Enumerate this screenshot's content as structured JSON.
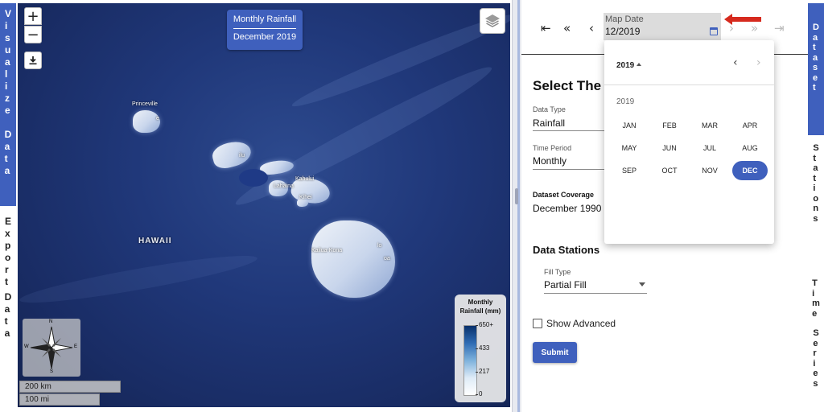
{
  "left_tabs": {
    "visualize": [
      "V",
      "i",
      "s",
      "u",
      "a",
      "l",
      "i",
      "z",
      "e"
    ],
    "data": [
      "D",
      "a",
      "t",
      "a"
    ],
    "export": [
      "E",
      "x",
      "p",
      "o",
      "r",
      "t"
    ],
    "data2": [
      "D",
      "a",
      "t",
      "a"
    ]
  },
  "map": {
    "zoom_in": "+",
    "zoom_out": "−",
    "download_icon": "download-icon",
    "layers_icon": "layers-icon",
    "title_line1": "Monthly Rainfall",
    "title_line2": "December 2019",
    "places": {
      "princeville": "Princeville",
      "hanalei": "e",
      "kailua": "ilu",
      "kahului": "Kahului",
      "lahaina": "Lahaina",
      "kihei": "Kihei",
      "hawaii": "HAWAII",
      "kona": "Kailua-Kona",
      "hilo": "lo",
      "waiakea": "oa"
    },
    "compass": {
      "n": "N",
      "s": "S",
      "e": "E",
      "w": "W"
    },
    "scale_km": "200 km",
    "scale_mi": "100 mi",
    "legend": {
      "title1": "Monthly",
      "title2": "Rainfall (mm)",
      "ticks": [
        "650+",
        "433",
        "217",
        "0"
      ],
      "colors": [
        "#08306b",
        "#2f6cb4",
        "#7eb2dc",
        "#deebf7",
        "#ffffff"
      ]
    }
  },
  "panel": {
    "nav_first": "⇤",
    "nav_prev_fast": "«",
    "nav_prev": "‹",
    "nav_next": "›",
    "nav_next_fast": "»",
    "nav_last": "⇥",
    "date_label": "Map Date",
    "date_value": "12/2019",
    "headline": "Select The D                              iew.",
    "data_type_label": "Data Type",
    "data_type_value": "Rainfall",
    "time_period_label": "Time Period",
    "time_period_value": "Monthly",
    "coverage_label": "Dataset Coverage",
    "coverage_value": "December 1990 -",
    "stations_title": "Data Stations",
    "fill_type_label": "Fill Type",
    "fill_type_value": "Partial Fill",
    "show_advanced": "Show Advanced",
    "submit": "Submit"
  },
  "picker": {
    "year_button": "2019",
    "prev": "‹",
    "next": "›",
    "year_label": "2019",
    "months": [
      "JAN",
      "FEB",
      "MAR",
      "APR",
      "MAY",
      "JUN",
      "JUL",
      "AUG",
      "SEP",
      "OCT",
      "NOV",
      "DEC"
    ],
    "selected": "DEC"
  },
  "right_tabs": {
    "dataset": [
      "D",
      "a",
      "t",
      "a",
      "s",
      "e",
      "t"
    ],
    "stations": [
      "S",
      "t",
      "a",
      "t",
      "i",
      "o",
      "n",
      "s"
    ],
    "time": [
      "T",
      "i",
      "m",
      "e"
    ],
    "series": [
      "S",
      "e",
      "r",
      "i",
      "e",
      "s"
    ]
  },
  "colors": {
    "accent": "#3f60bd",
    "arrow": "#d62a1e"
  }
}
